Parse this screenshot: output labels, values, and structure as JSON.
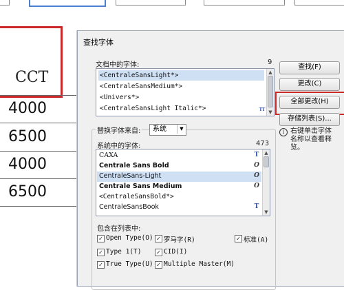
{
  "document": {
    "table_header": "CCT",
    "rows": [
      "4000",
      "6500",
      "4000",
      "6500"
    ]
  },
  "dialog": {
    "title": "查找字体",
    "doc_fonts": {
      "label": "文档中的字体:",
      "count": "9",
      "items": [
        "<CentraleSansLight*>",
        "<CentraleSansMedium*>",
        "<Univers*>",
        "<CentraleSansLight Italic*>"
      ]
    },
    "buttons": {
      "find": "查找(F)",
      "change": "更改(C)",
      "change_all": "全部更改(H)",
      "save_list": "存储列表(S)..."
    },
    "replace": {
      "label": "替换字体来自:",
      "source_value": "系统"
    },
    "system_fonts": {
      "label": "系统中的字体:",
      "count": "473",
      "items": [
        {
          "name": "CAXA",
          "icon": "truetype-icon"
        },
        {
          "name": "Centrale Sans Bold",
          "icon": "opentype-icon"
        },
        {
          "name": "CentraleSans-Light",
          "icon": "opentype-icon"
        },
        {
          "name": "Centrale Sans Medium",
          "icon": "opentype-icon"
        },
        {
          "name": "<CentraleSansBold*>",
          "icon": ""
        },
        {
          "name": "CentraleSansBook",
          "icon": "truetype-icon"
        }
      ]
    },
    "include": {
      "label": "包含在列表中:",
      "options": [
        {
          "label": "Open Type(O)",
          "checked": true
        },
        {
          "label": "罗马字(R)",
          "checked": true
        },
        {
          "label": "标准(A)",
          "checked": true
        },
        {
          "label": "Type 1(T)",
          "checked": true
        },
        {
          "label": "CID(I)",
          "checked": true
        },
        {
          "label": "True Type(U)",
          "checked": true
        },
        {
          "label": "Multiple Master(M)",
          "checked": true
        }
      ]
    },
    "tip": "右键单击字体名称以查看释览。",
    "tip_lines": [
      "右键单击字体",
      "名称以查看释",
      "览。"
    ]
  },
  "colors": {
    "highlight_red": "#cc2a2a",
    "selection_blue": "#cfe0f5"
  }
}
